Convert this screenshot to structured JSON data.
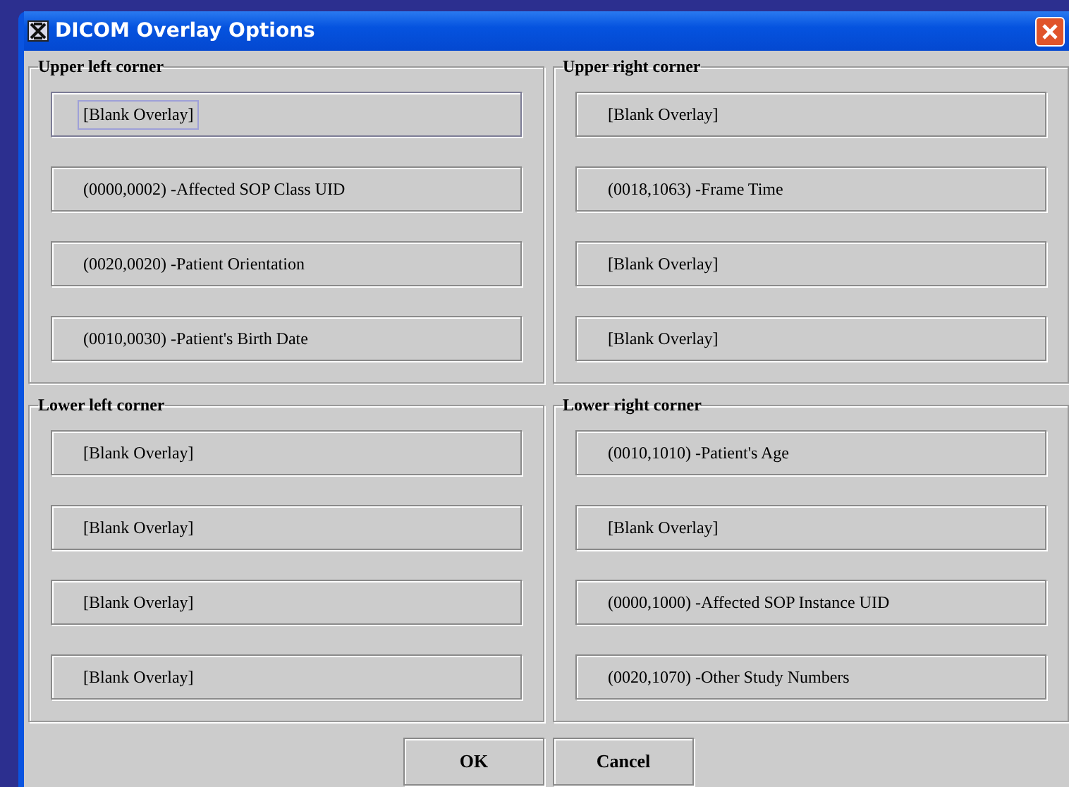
{
  "window": {
    "title": "DICOM Overlay Options"
  },
  "corners": [
    {
      "label": "Upper left corner",
      "slots": [
        {
          "text": "[Blank Overlay]",
          "focused": true
        },
        {
          "text": "(0000,0002) -Affected SOP Class UID",
          "focused": false
        },
        {
          "text": "(0020,0020) -Patient Orientation",
          "focused": false
        },
        {
          "text": "(0010,0030) -Patient's Birth Date",
          "focused": false
        }
      ]
    },
    {
      "label": "Upper right corner",
      "slots": [
        {
          "text": "[Blank Overlay]",
          "focused": false
        },
        {
          "text": "(0018,1063) -Frame Time",
          "focused": false
        },
        {
          "text": "[Blank Overlay]",
          "focused": false
        },
        {
          "text": "[Blank Overlay]",
          "focused": false
        }
      ]
    },
    {
      "label": "Lower left corner",
      "slots": [
        {
          "text": "[Blank Overlay]",
          "focused": false
        },
        {
          "text": "[Blank Overlay]",
          "focused": false
        },
        {
          "text": "[Blank Overlay]",
          "focused": false
        },
        {
          "text": "[Blank Overlay]",
          "focused": false
        }
      ]
    },
    {
      "label": "Lower right corner",
      "slots": [
        {
          "text": "(0010,1010) -Patient's Age",
          "focused": false
        },
        {
          "text": "[Blank Overlay]",
          "focused": false
        },
        {
          "text": "(0000,1000) -Affected SOP Instance UID",
          "focused": false
        },
        {
          "text": "(0020,1070) -Other Study Numbers",
          "focused": false
        }
      ]
    }
  ],
  "buttons": [
    "OK",
    "Cancel"
  ]
}
